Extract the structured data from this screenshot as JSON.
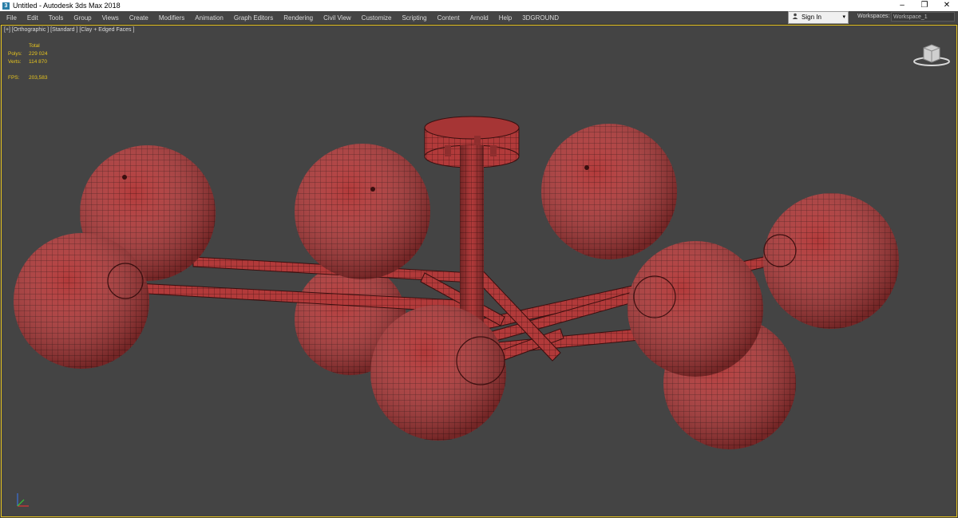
{
  "window": {
    "title": "Untitled - Autodesk 3ds Max 2018",
    "app_icon_glyph": "3",
    "controls": {
      "minimize": "–",
      "restore": "❐",
      "close": "✕"
    }
  },
  "menu": {
    "items": [
      "File",
      "Edit",
      "Tools",
      "Group",
      "Views",
      "Create",
      "Modifiers",
      "Animation",
      "Graph Editors",
      "Rendering",
      "Civil View",
      "Customize",
      "Scripting",
      "Content",
      "Arnold",
      "Help",
      "3DGROUND"
    ]
  },
  "account": {
    "sign_in": "Sign In",
    "user_icon": "user-icon",
    "caret": "▾"
  },
  "workspace": {
    "label": "Workspaces:",
    "value": "Workspace_1"
  },
  "viewport": {
    "label": "[+] [Orthographic ] [Standard ] [Clay + Edged Faces ]",
    "border_color": "#e8c51e",
    "stats": {
      "header": "Total",
      "polys_label": "Polys:",
      "polys_value": "229 024",
      "verts_label": "Verts:",
      "verts_value": "114 870",
      "fps_label": "FPS:",
      "fps_value": "203,583"
    }
  },
  "model": {
    "shade_color": "#b23a3a",
    "wire_color": "#3a0f0f"
  },
  "icons": {
    "viewcube": "viewcube-icon",
    "axis": "axis-tripod-icon"
  }
}
